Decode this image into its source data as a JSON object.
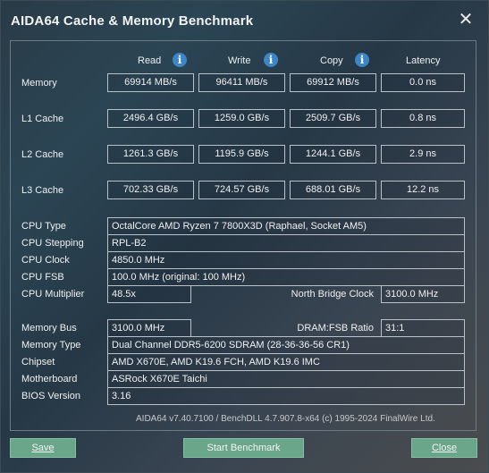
{
  "window": {
    "title": "AIDA64 Cache & Memory Benchmark",
    "close_glyph": "✕"
  },
  "columns": {
    "read": "Read",
    "write": "Write",
    "copy": "Copy",
    "latency": "Latency",
    "info_glyph": "i"
  },
  "rows": {
    "memory": {
      "label": "Memory",
      "read": "69914 MB/s",
      "write": "96411 MB/s",
      "copy": "69912 MB/s",
      "latency": "0.0 ns"
    },
    "l1": {
      "label": "L1 Cache",
      "read": "2496.4 GB/s",
      "write": "1259.0 GB/s",
      "copy": "2509.7 GB/s",
      "latency": "0.8 ns"
    },
    "l2": {
      "label": "L2 Cache",
      "read": "1261.3 GB/s",
      "write": "1195.9 GB/s",
      "copy": "1244.1 GB/s",
      "latency": "2.9 ns"
    },
    "l3": {
      "label": "L3 Cache",
      "read": "702.33 GB/s",
      "write": "724.57 GB/s",
      "copy": "688.01 GB/s",
      "latency": "12.2 ns"
    }
  },
  "cpu": {
    "type_label": "CPU Type",
    "type": "OctalCore AMD Ryzen 7 7800X3D  (Raphael, Socket AM5)",
    "stepping_label": "CPU Stepping",
    "stepping": "RPL-B2",
    "clock_label": "CPU Clock",
    "clock": "4850.0 MHz",
    "fsb_label": "CPU FSB",
    "fsb": "100.0 MHz  (original: 100 MHz)",
    "multiplier_label": "CPU Multiplier",
    "multiplier": "48.5x",
    "nb_clock_label": "North Bridge Clock",
    "nb_clock": "3100.0 MHz"
  },
  "memory_info": {
    "bus_label": "Memory Bus",
    "bus": "3100.0 MHz",
    "ratio_label": "DRAM:FSB Ratio",
    "ratio": "31:1",
    "type_label": "Memory Type",
    "type": "Dual Channel DDR5-6200 SDRAM  (28-36-36-56 CR1)",
    "chipset_label": "Chipset",
    "chipset": "AMD X670E, AMD K19.6 FCH, AMD K19.6 IMC",
    "motherboard_label": "Motherboard",
    "motherboard": "ASRock X670E Taichi",
    "bios_label": "BIOS Version",
    "bios": "3.16"
  },
  "footer": "AIDA64 v7.40.7100 / BenchDLL 4.7.907.8-x64  (c) 1995-2024 FinalWire Ltd.",
  "buttons": {
    "save": "Save",
    "start": "Start Benchmark",
    "close": "Close"
  }
}
